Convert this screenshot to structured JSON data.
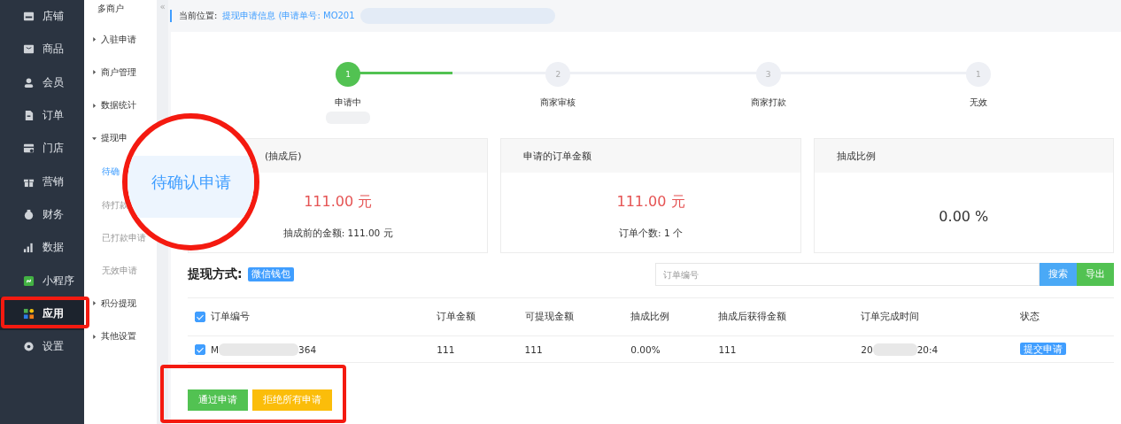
{
  "sidebar": {
    "items": [
      {
        "label": "店铺",
        "selected": false
      },
      {
        "label": "商品",
        "selected": false
      },
      {
        "label": "会员",
        "selected": false
      },
      {
        "label": "订单",
        "selected": false
      },
      {
        "label": "门店",
        "selected": false
      },
      {
        "label": "营销",
        "selected": false
      },
      {
        "label": "财务",
        "selected": false
      },
      {
        "label": "数据",
        "selected": false
      },
      {
        "label": "小程序",
        "selected": false
      },
      {
        "label": "应用",
        "selected": true
      },
      {
        "label": "设置",
        "selected": false
      }
    ]
  },
  "submenu": {
    "title": "多商户",
    "collapse": "«",
    "items": [
      {
        "label": "入驻申请",
        "expanded": false
      },
      {
        "label": "商户管理",
        "expanded": false
      },
      {
        "label": "数据统计",
        "expanded": false
      },
      {
        "label": "提现申",
        "expanded": true,
        "children": [
          {
            "label": "待确",
            "selected": true
          },
          {
            "label": "待打款",
            "selected": false
          },
          {
            "label": "已打款申请",
            "selected": false
          },
          {
            "label": "无效申请",
            "selected": false
          }
        ]
      },
      {
        "label": "积分提现",
        "expanded": false
      },
      {
        "label": "其他设置",
        "expanded": false
      }
    ]
  },
  "breadcrumb": {
    "label": "当前位置:",
    "path": "提现申请信息 (申请单号: MO201"
  },
  "steps": [
    {
      "number": "1",
      "label": "申请中",
      "done": true
    },
    {
      "number": "2",
      "label": "商家审核",
      "done": false
    },
    {
      "number": "3",
      "label": "商家打款",
      "done": false
    },
    {
      "number": "1",
      "label": "无效",
      "done": false
    }
  ],
  "progress": {
    "level": 0.167
  },
  "cards": [
    {
      "title": "(抽成后)",
      "value": "111.00 元",
      "note": "抽成前的金额: 111.00 元",
      "highlight": true
    },
    {
      "title": "申请的订单金额",
      "value": "111.00 元",
      "note": "订单个数: 1 个",
      "highlight": true
    },
    {
      "title": "抽成比例",
      "value": "0.00 %",
      "highlight": false
    }
  ],
  "payment": {
    "label": "提现方式:",
    "tag": "微信钱包"
  },
  "search": {
    "placeholder": "订单编号",
    "buttons": [
      {
        "label": "搜索",
        "kind": "search"
      },
      {
        "label": "导出",
        "kind": "export"
      }
    ]
  },
  "table": {
    "all_checked": true,
    "columns": [
      "订单编号",
      "订单金额",
      "可提现金额",
      "抽成比例",
      "抽成后获得金额",
      "订单完成时间",
      "状态"
    ],
    "rows": [
      {
        "checked": true,
        "order_no": {
          "start": "M",
          "end": "364"
        },
        "amount": "111",
        "withdrawable": "111",
        "rate": "0.00%",
        "net": "111",
        "finished": {
          "start": "20",
          "end": "20:4"
        },
        "status": "提交申请"
      }
    ]
  },
  "actions": [
    {
      "label": "通过申请",
      "kind": "approve"
    },
    {
      "label": "拒绝所有申请",
      "kind": "reject"
    }
  ],
  "magnifier": {
    "label": "待确认申请"
  }
}
